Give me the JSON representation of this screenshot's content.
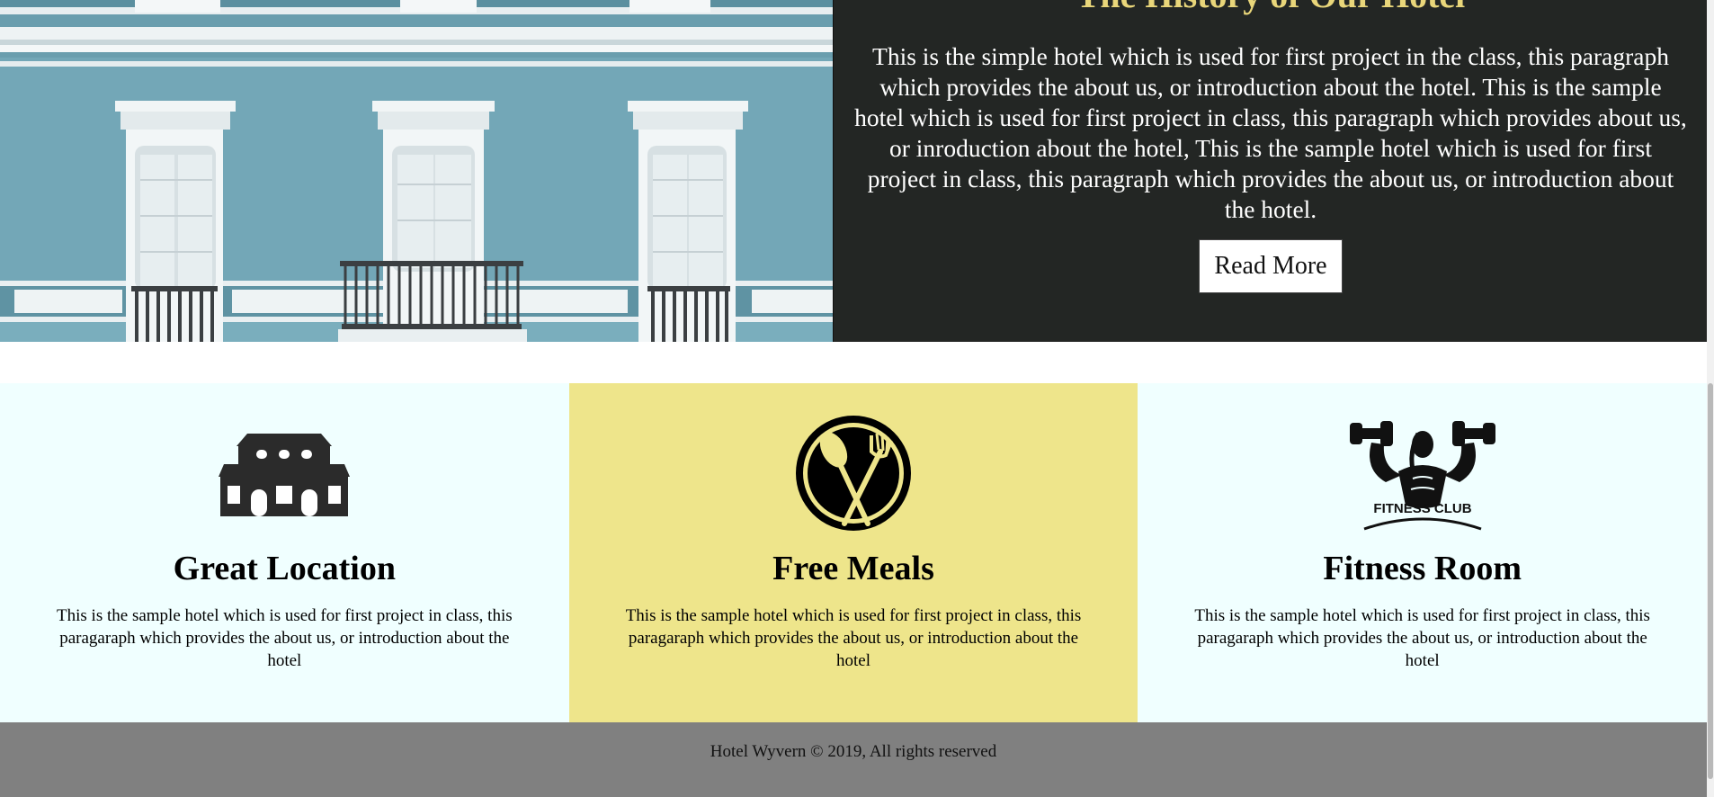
{
  "about": {
    "heading": "The History of Our Hotel",
    "text": "This is the simple hotel which is used for first project in the class, this paragraph which provides the about us, or introduction about the hotel. This is the sample hotel which is used for first project in class, this paragraph which provides about us, or inroduction about the hotel, This is the sample hotel which is used for first project in class, this paragraph which provides the about us, or introduction about the hotel.",
    "button_label": "Read More"
  },
  "features": [
    {
      "title": "Great Location",
      "icon": "hotel-building-icon",
      "text": "This is the sample hotel which is used for first project in class, this paragaraph which provides the about us, or introduction about the hotel"
    },
    {
      "title": "Free Meals",
      "icon": "spoon-fork-icon",
      "text": "This is the sample hotel which is used for first project in class, this paragaraph which provides the about us, or introduction about the hotel"
    },
    {
      "title": "Fitness Room",
      "icon": "fitness-club-icon",
      "icon_label": "FITNESS CLUB",
      "text": "This is the sample hotel which is used for first project in class, this paragaraph which provides the about us, or introduction about the hotel"
    }
  ],
  "footer": {
    "text": "Hotel Wyvern © 2019, All rights reserved"
  },
  "colors": {
    "about_bg": "#232624",
    "about_heading": "#e9d67a",
    "feature_light_bg": "#f0ffff",
    "feature_yellow_bg": "#eee58b",
    "footer_bg": "#808080"
  }
}
